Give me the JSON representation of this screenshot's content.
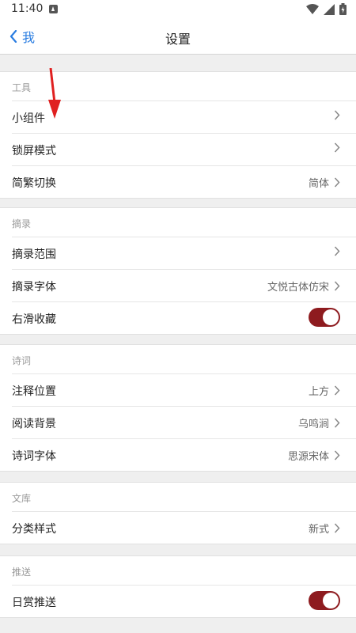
{
  "status_bar": {
    "time": "11:40"
  },
  "nav": {
    "back_label": "我",
    "title": "设置"
  },
  "sections": [
    {
      "header": "工具",
      "rows": [
        {
          "label": "小组件",
          "value": ""
        },
        {
          "label": "锁屏模式",
          "value": ""
        },
        {
          "label": "简繁切换",
          "value": "简体"
        }
      ]
    },
    {
      "header": "摘录",
      "rows": [
        {
          "label": "摘录范围",
          "value": ""
        },
        {
          "label": "摘录字体",
          "value": "文悦古体仿宋"
        },
        {
          "label": "右滑收藏",
          "toggle": true
        }
      ]
    },
    {
      "header": "诗词",
      "rows": [
        {
          "label": "注释位置",
          "value": "上方"
        },
        {
          "label": "阅读背景",
          "value": "乌鸣涧"
        },
        {
          "label": "诗词字体",
          "value": "思源宋体"
        }
      ]
    },
    {
      "header": "文库",
      "rows": [
        {
          "label": "分类样式",
          "value": "新式"
        }
      ]
    },
    {
      "header": "推送",
      "rows": [
        {
          "label": "日赏推送",
          "toggle": true
        }
      ]
    }
  ],
  "colors": {
    "accent_blue": "#2a7de1",
    "toggle_on": "#8e1b1f",
    "annotation_arrow": "#e02020"
  }
}
